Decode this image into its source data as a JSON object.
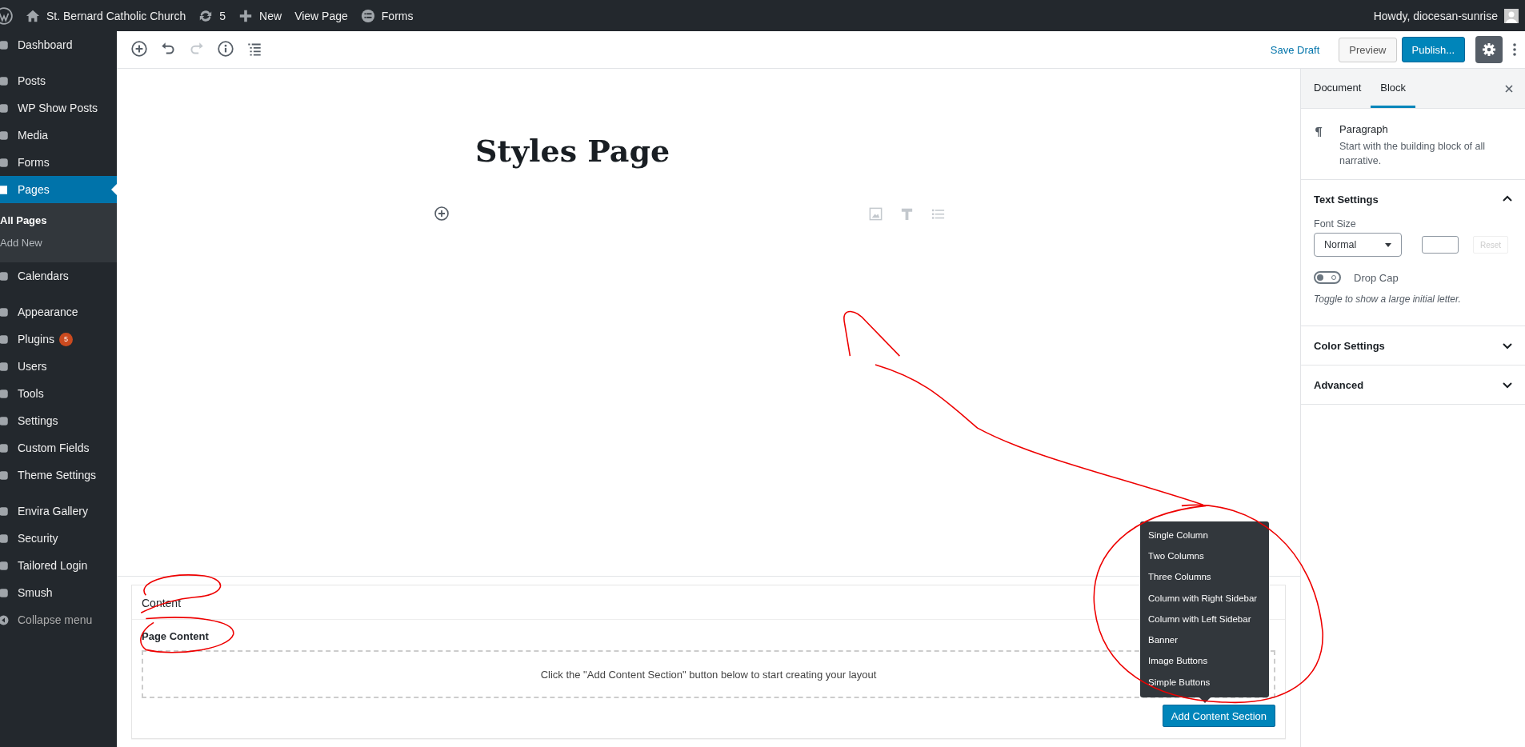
{
  "admin_bar": {
    "site": "St. Bernard Catholic Church",
    "updates": "5",
    "new": "New",
    "view_page": "View Page",
    "forms": "Forms",
    "greeting": "Howdy, diocesan-sunrise"
  },
  "sidebar": {
    "groups": [
      {
        "items": [
          {
            "label": "Dashboard",
            "selected": false
          }
        ]
      },
      {
        "items": [
          {
            "label": "Posts",
            "selected": false
          },
          {
            "label": "WP Show Posts",
            "selected": false
          },
          {
            "label": "Media",
            "selected": false
          },
          {
            "label": "Forms",
            "selected": false
          },
          {
            "label": "Pages",
            "selected": true,
            "children": [
              {
                "label": "All Pages",
                "selected": true
              },
              {
                "label": "Add New",
                "selected": false
              }
            ]
          },
          {
            "label": "Calendars",
            "selected": false
          }
        ]
      },
      {
        "items": [
          {
            "label": "Appearance",
            "selected": false
          },
          {
            "label": "Plugins",
            "selected": false,
            "badge": "5"
          },
          {
            "label": "Users",
            "selected": false
          },
          {
            "label": "Tools",
            "selected": false
          },
          {
            "label": "Settings",
            "selected": false
          },
          {
            "label": "Custom Fields",
            "selected": false
          },
          {
            "label": "Theme Settings",
            "selected": false
          }
        ]
      },
      {
        "items": [
          {
            "label": "Envira Gallery",
            "selected": false
          },
          {
            "label": "Security",
            "selected": false
          },
          {
            "label": "Tailored Login",
            "selected": false
          },
          {
            "label": "Smush",
            "selected": false
          },
          {
            "label": "Collapse menu",
            "selected": false,
            "kind": "collapse"
          }
        ]
      }
    ]
  },
  "toolbar": {
    "tools": [
      {
        "kind": "add",
        "disabled": false
      },
      {
        "kind": "undo",
        "disabled": false
      },
      {
        "kind": "redo",
        "disabled": true
      },
      {
        "kind": "info",
        "disabled": false
      },
      {
        "kind": "outline",
        "disabled": false
      }
    ],
    "save_draft": "Save Draft",
    "preview": "Preview",
    "publish": "Publish...",
    "settings_on": true
  },
  "editor": {
    "title": "Styles Page"
  },
  "settings_panel": {
    "tabs": [
      {
        "label": "Document",
        "selected": false
      },
      {
        "label": "Block",
        "selected": true
      }
    ],
    "block": {
      "name": "Paragraph",
      "description": "Start with the building block of all narrative."
    },
    "text_settings": {
      "title": "Text Settings",
      "expanded": true,
      "font_size_label": "Font Size",
      "font_size": "Normal",
      "reset": "Reset",
      "reset_disabled": true,
      "drop_cap": {
        "label": "Drop Cap",
        "on": false
      },
      "help": "Toggle to show a large initial letter."
    },
    "panels": [
      {
        "title": "Color Settings",
        "expanded": false
      },
      {
        "title": "Advanced",
        "expanded": false
      }
    ]
  },
  "metabox": {
    "title": "Content",
    "field_label": "Page Content",
    "empty_message": "Click the \"Add Content Section\" button below to start creating your layout",
    "button": "Add Content Section",
    "menu": [
      "Single Column",
      "Two Columns",
      "Three Columns",
      "Column with Right Sidebar",
      "Column with Left Sidebar",
      "Banner",
      "Image Buttons",
      "Simple Buttons"
    ]
  }
}
